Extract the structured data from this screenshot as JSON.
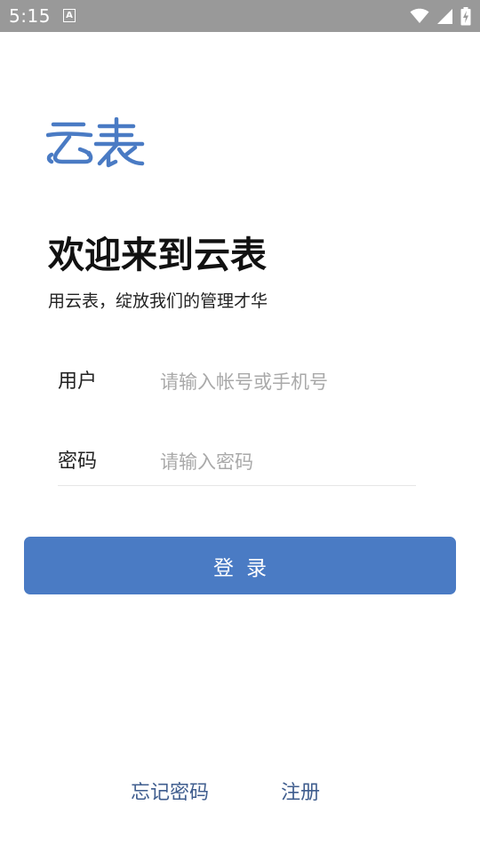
{
  "status_bar": {
    "time": "5:15",
    "notification_icon": "A",
    "icons": [
      "wifi-icon",
      "signal-icon",
      "battery-charging-icon"
    ]
  },
  "logo": {
    "text": "云表",
    "color": "#4a7bc4"
  },
  "header": {
    "title": "欢迎来到云表",
    "subtitle": "用云表，绽放我们的管理才华"
  },
  "form": {
    "username": {
      "label": "用户",
      "placeholder": "请输入帐号或手机号",
      "value": ""
    },
    "password": {
      "label": "密码",
      "placeholder": "请输入密码",
      "value": ""
    },
    "login_label": "登录"
  },
  "footer": {
    "forgot_password": "忘记密码",
    "register": "注册"
  },
  "colors": {
    "primary": "#4a7bc4",
    "link": "#3f5d8e",
    "status_bar": "#999999"
  }
}
